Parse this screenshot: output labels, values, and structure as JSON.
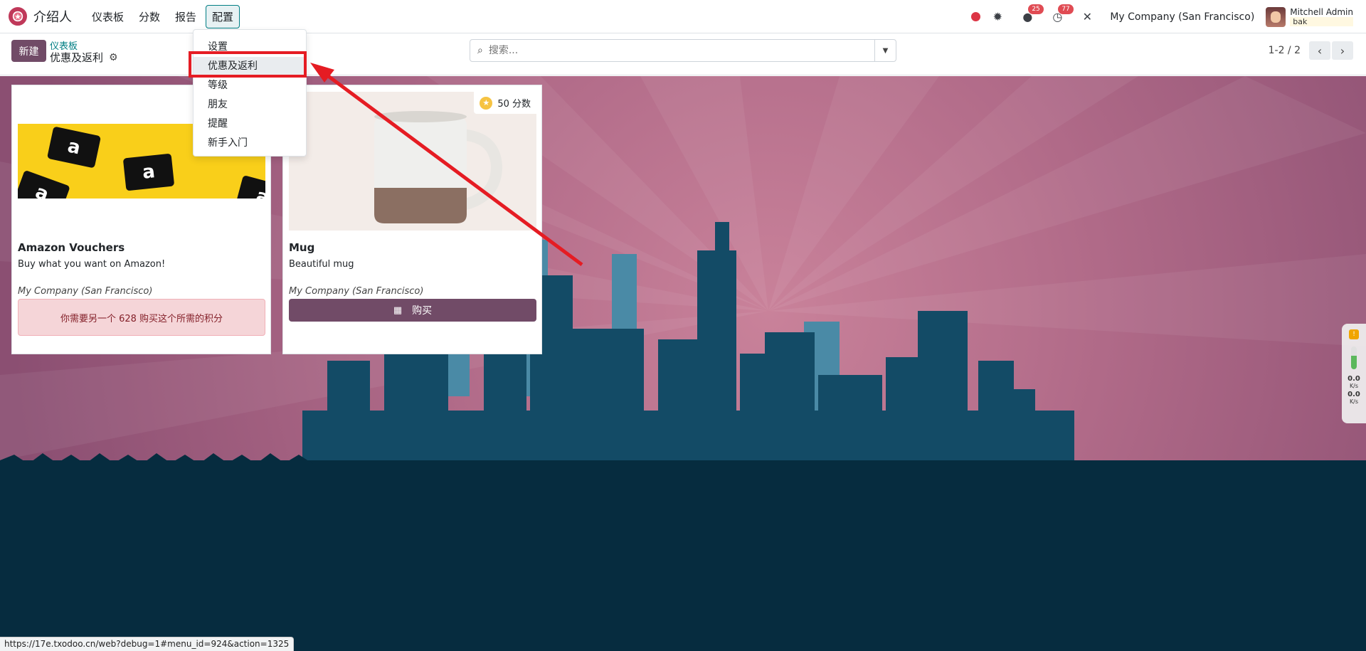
{
  "navbar": {
    "app_name": "介绍人",
    "menu": [
      "仪表板",
      "分数",
      "报告",
      "配置"
    ],
    "active_menu": "配置",
    "chat_badge": "25",
    "activity_badge": "77",
    "company": "My Company (San Francisco)",
    "user_name": "Mitchell Admin",
    "user_db": "bak"
  },
  "control_panel": {
    "new_label": "新建",
    "breadcrumb": "仪表板",
    "title": "优惠及返利",
    "search_placeholder": "搜索...",
    "pager": "1-2 / 2"
  },
  "dropdown": {
    "items": [
      "设置",
      "优惠及返利",
      "等级",
      "朋友",
      "提醒",
      "新手入门"
    ],
    "highlighted": "优惠及返利"
  },
  "cards": [
    {
      "title": "Amazon Vouchers",
      "description": "Buy what you want on Amazon!",
      "company": "My Company (San Francisco)",
      "alert": "你需要另一个 628 购买这个所需的积分"
    },
    {
      "title": "Mug",
      "description": "Beautiful mug",
      "company": "My Company (San Francisco)",
      "points": "50 分数",
      "buy_label": "购买"
    }
  ],
  "side_widget": {
    "up_value": "0.0",
    "up_unit": "K/s",
    "down_value": "0.0",
    "down_unit": "K/s"
  },
  "status_url": "https://17e.txodoo.cn/web?debug=1#menu_id=924&action=1325",
  "colors": {
    "primary": "#714b67",
    "accent": "#017e84",
    "highlight": "#e51c23"
  }
}
